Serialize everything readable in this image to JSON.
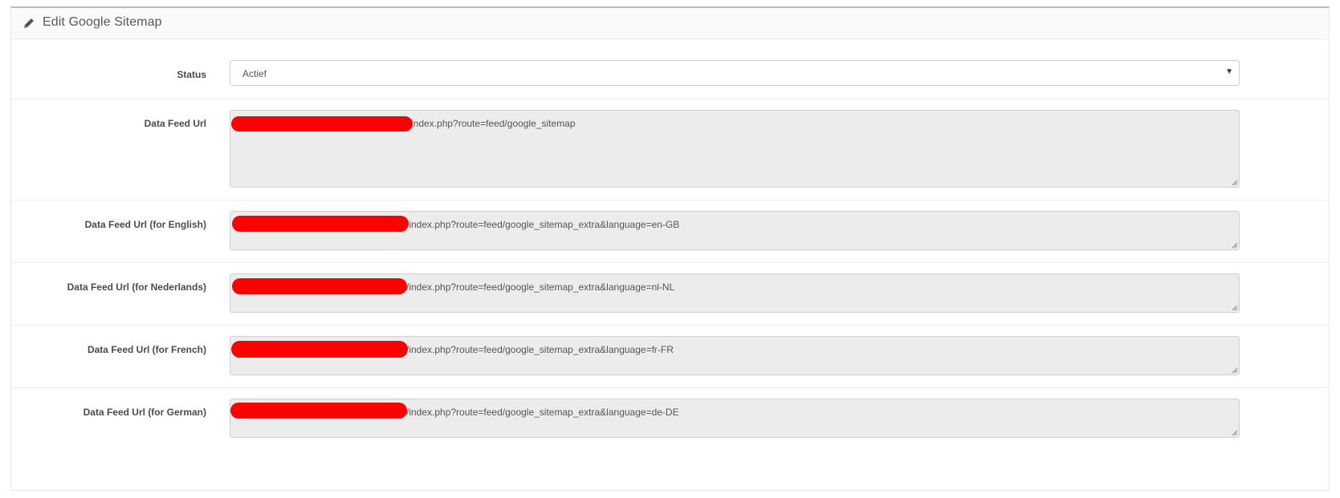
{
  "header": {
    "icon": "pencil-icon",
    "title": "Edit Google Sitemap"
  },
  "status": {
    "label": "Status",
    "selected": "Actief"
  },
  "feeds": [
    {
      "label": "Data Feed Url",
      "url_suffix": "index.php?route=feed/google_sitemap"
    },
    {
      "label": "Data Feed Url (for English)",
      "url_suffix": "/index.php?route=feed/google_sitemap_extra&language=en-GB"
    },
    {
      "label": "Data Feed Url (for Nederlands)",
      "url_suffix": "/index.php?route=feed/google_sitemap_extra&language=nl-NL"
    },
    {
      "label": "Data Feed Url (for French)",
      "url_suffix": "/index.php?route=feed/google_sitemap_extra&language=fr-FR"
    },
    {
      "label": "Data Feed Url (for German)",
      "url_suffix": "/index.php?route=feed/google_sitemap_extra&language=de-DE"
    }
  ],
  "colors": {
    "redaction": "#ff0000",
    "readonly_bg": "#ececec"
  }
}
